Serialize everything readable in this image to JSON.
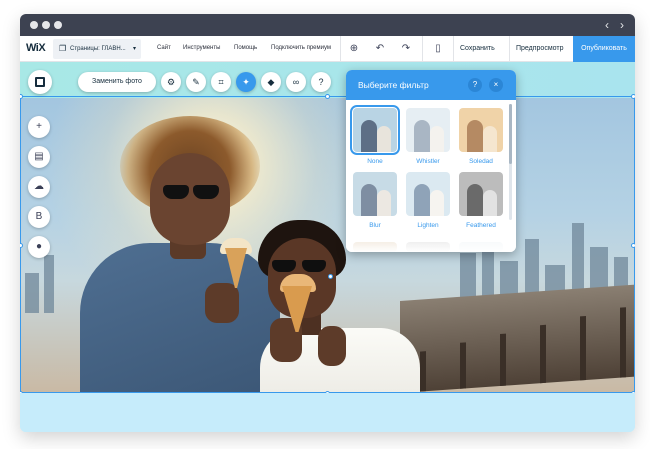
{
  "window": {
    "nav_back": "‹",
    "nav_forward": "›"
  },
  "topbar": {
    "logo": "WiX",
    "pages_label": "Страницы: ГЛАВН...",
    "pages_caret": "▾",
    "menu": [
      "Сайт",
      "Инструменты",
      "Помощь",
      "Подключить премиум"
    ],
    "icons": {
      "zoom": "⊕",
      "undo": "↶",
      "redo": "↷",
      "mobile": "▯"
    },
    "save_label": "Сохранить",
    "preview_label": "Предпросмотр",
    "publish_label": "Опубликовать"
  },
  "photo_toolbar": {
    "change_photo_label": "Заменить фото",
    "buttons": [
      {
        "name": "settings-icon",
        "glyph": "⚙"
      },
      {
        "name": "brush-icon",
        "glyph": "✎"
      },
      {
        "name": "crop-icon",
        "glyph": "⌗"
      },
      {
        "name": "filter-icon",
        "glyph": "✦",
        "active": true
      },
      {
        "name": "animation-icon",
        "glyph": "◆"
      },
      {
        "name": "link-icon",
        "glyph": "∞"
      },
      {
        "name": "help-icon",
        "glyph": "?"
      }
    ]
  },
  "left_tools": [
    {
      "name": "add-icon",
      "glyph": "+"
    },
    {
      "name": "background-icon",
      "glyph": "▤"
    },
    {
      "name": "upload-icon",
      "glyph": "☁"
    },
    {
      "name": "blog-icon",
      "glyph": "B"
    },
    {
      "name": "chat-icon",
      "glyph": "●"
    }
  ],
  "filter_panel": {
    "title": "Выберите фильтр",
    "help": "?",
    "close": "×",
    "filters": [
      {
        "label": "None",
        "selected": true,
        "sky": "#b9d4e4",
        "p1": "#5d6f86",
        "p2": "#e8e4dc"
      },
      {
        "label": "Whistler",
        "selected": false,
        "sky": "#e6eef3",
        "p1": "#a9b6c4",
        "p2": "#f4f2ee"
      },
      {
        "label": "Soledad",
        "selected": false,
        "sky": "#f0d3a8",
        "p1": "#b58a63",
        "p2": "#f5e6cf"
      },
      {
        "label": "Blur",
        "selected": false,
        "sky": "#c7dbe6",
        "p1": "#7e8ea2",
        "p2": "#ece8e2"
      },
      {
        "label": "Lighten",
        "selected": false,
        "sky": "#dbe9f1",
        "p1": "#8fa3b8",
        "p2": "#f6f4f0"
      },
      {
        "label": "Feathered",
        "selected": false,
        "sky": "#bcbcbc",
        "p1": "#6a6a6a",
        "p2": "#e2e2e2"
      }
    ]
  },
  "colors": {
    "accent": "#3899ec",
    "titlebar": "#3d4251",
    "stage": "#bfeaf0"
  }
}
